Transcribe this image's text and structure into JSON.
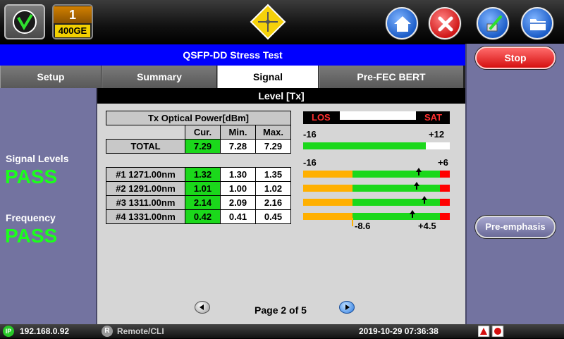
{
  "header": {
    "port_number": "1",
    "port_rate": "400GE",
    "title": "QSFP-DD Stress Test"
  },
  "tabs": [
    {
      "label": "Setup",
      "active": false
    },
    {
      "label": "Summary",
      "active": false
    },
    {
      "label": "Signal",
      "active": true
    },
    {
      "label": "Pre-FEC BERT",
      "active": false
    }
  ],
  "left_panel": {
    "signal_levels_label": "Signal Levels",
    "signal_levels_value": "PASS",
    "frequency_label": "Frequency",
    "frequency_value": "PASS"
  },
  "section_header": "Level [Tx]",
  "power_table": {
    "title": "Tx Optical Power[dBm]",
    "columns": [
      "Cur.",
      "Min.",
      "Max."
    ],
    "total": {
      "label": "TOTAL",
      "cur": "7.29",
      "min": "7.28",
      "max": "7.29"
    },
    "lanes": [
      {
        "label": "#1 1271.00nm",
        "cur": "1.32",
        "min": "1.30",
        "max": "1.35"
      },
      {
        "label": "#2 1291.00nm",
        "cur": "1.01",
        "min": "1.00",
        "max": "1.02"
      },
      {
        "label": "#3 1311.00nm",
        "cur": "2.14",
        "min": "2.09",
        "max": "2.16"
      },
      {
        "label": "#4 1331.00nm",
        "cur": "0.42",
        "min": "0.41",
        "max": "0.45"
      }
    ]
  },
  "gauges": {
    "los_label": "LOS",
    "sat_label": "SAT",
    "total_min": "-16",
    "total_max": "+12",
    "lane_min": "-16",
    "lane_max": "+6",
    "lower_threshold": "-8.6",
    "upper_threshold": "+4.5"
  },
  "pager": {
    "text": "Page 2 of 5"
  },
  "right_panel": {
    "stop_label": "Stop",
    "preemphasis_label": "Pre-emphasis"
  },
  "status_bar": {
    "ip": "192.168.0.92",
    "remote": "Remote/CLI",
    "datetime": "2019-10-29  07:36:38"
  },
  "colors": {
    "title_bar": "#0000ff",
    "panel": "#7373a0",
    "pass": "#1bff1b",
    "level_green": "#1bd81b",
    "level_orange": "#ffb000",
    "level_red": "#ff0000"
  }
}
